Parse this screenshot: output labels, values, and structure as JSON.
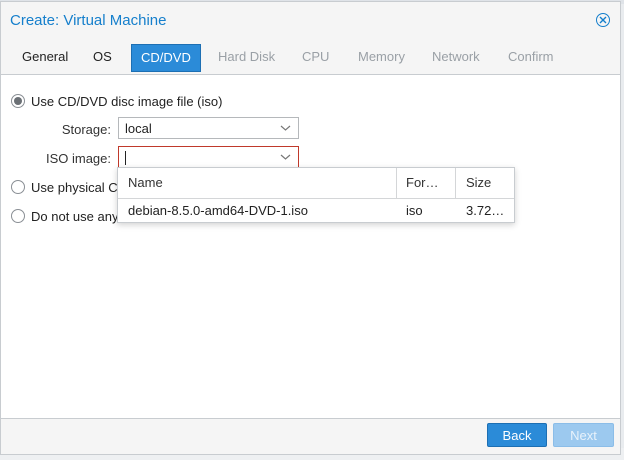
{
  "dialog": {
    "title": "Create: Virtual Machine"
  },
  "tabs": [
    {
      "label": "General",
      "state": "normal"
    },
    {
      "label": "OS",
      "state": "normal"
    },
    {
      "label": "CD/DVD",
      "state": "active"
    },
    {
      "label": "Hard Disk",
      "state": "disabled"
    },
    {
      "label": "CPU",
      "state": "disabled"
    },
    {
      "label": "Memory",
      "state": "disabled"
    },
    {
      "label": "Network",
      "state": "disabled"
    },
    {
      "label": "Confirm",
      "state": "disabled"
    }
  ],
  "options": {
    "iso_label": "Use CD/DVD disc image file (iso)",
    "physical_label": "Use physical C",
    "none_label": "Do not use any"
  },
  "fields": {
    "storage_label": "Storage:",
    "storage_value": "local",
    "iso_label": "ISO image:",
    "iso_value": ""
  },
  "dropdown": {
    "columns": [
      "Name",
      "For…",
      "Size"
    ],
    "rows": [
      [
        "debian-8.5.0-amd64-DVD-1.iso",
        "iso",
        "3.72…"
      ]
    ]
  },
  "buttons": {
    "back": "Back",
    "next": "Next"
  },
  "colors": {
    "accent": "#2b8bd8",
    "title": "#157fcc",
    "error_border": "#c0392b"
  }
}
